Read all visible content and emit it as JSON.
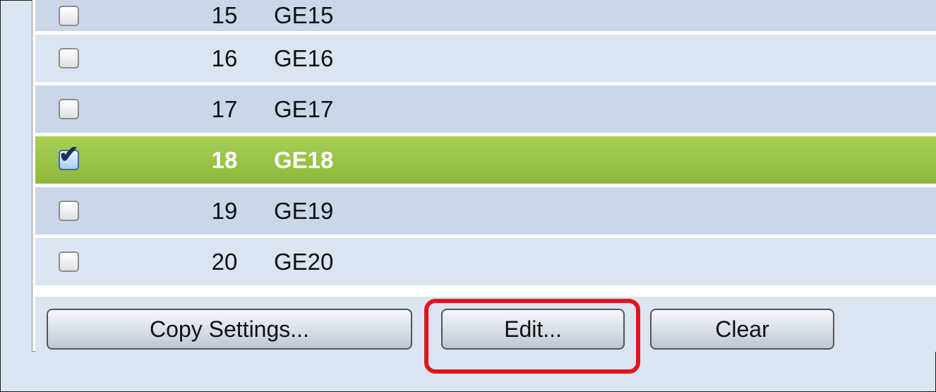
{
  "ports": [
    {
      "number": "15",
      "name": "GE15",
      "checked": false
    },
    {
      "number": "16",
      "name": "GE16",
      "checked": false
    },
    {
      "number": "17",
      "name": "GE17",
      "checked": false
    },
    {
      "number": "18",
      "name": "GE18",
      "checked": true
    },
    {
      "number": "19",
      "name": "GE19",
      "checked": false
    },
    {
      "number": "20",
      "name": "GE20",
      "checked": false
    }
  ],
  "buttons": {
    "copy_label": "Copy Settings...",
    "edit_label": "Edit...",
    "clear_label": "Clear"
  },
  "colors": {
    "row": "#c9d7e8",
    "row_alt": "#dbe5f1",
    "selected": "#9cc64a",
    "highlight": "#e0161d"
  }
}
